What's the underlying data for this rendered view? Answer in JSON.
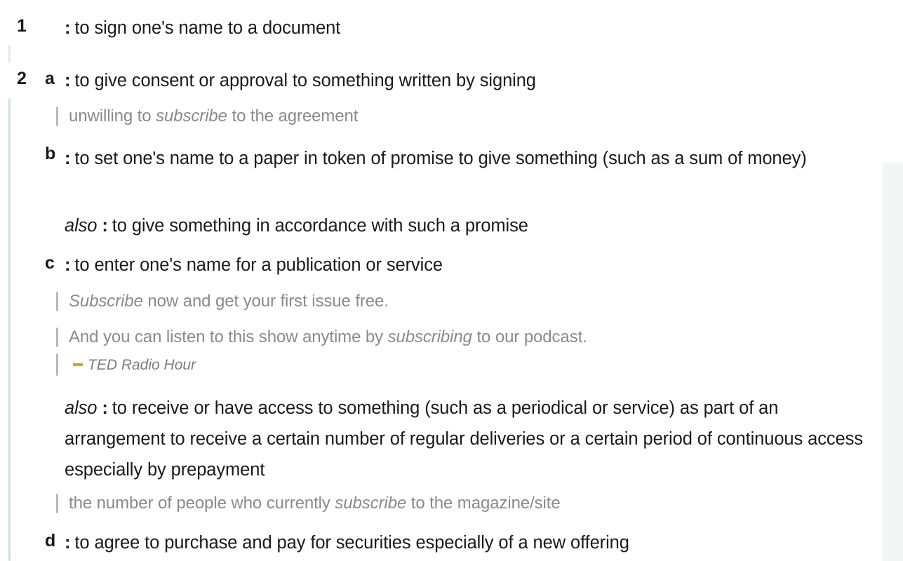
{
  "colors": {
    "sense_rule": "#cfdfd6",
    "sense_rule_faint": "#e4e7e6",
    "quote_bar": "#b9b9b9",
    "attribution_dash": "#c7a935",
    "text": "#1a1a1a",
    "example_text": "#8a8a8a",
    "side_panel": "#f4f5f5",
    "background": "#ffffff"
  },
  "senses": [
    {
      "number": "1",
      "letter": "",
      "colon": ":",
      "definition": "to sign one's name to a document"
    },
    {
      "number": "2",
      "letter": "a",
      "colon": ":",
      "definition": "to give consent or approval to something written by signing",
      "example_1_pre": "unwilling to ",
      "example_1_em": "subscribe",
      "example_1_post": " to the agreement"
    },
    {
      "number": "",
      "letter": "b",
      "colon": ":",
      "definition": "to set one's name to a paper in token of promise to give something (such as a sum of money)",
      "also_label": "also",
      "also_colon": ":",
      "also_definition": "to give something in accordance with such a promise"
    },
    {
      "number": "",
      "letter": "c",
      "colon": ":",
      "definition": "to enter one's name for a publication or service",
      "example_1_em": "Subscribe",
      "example_1_post": " now and get your first issue free.",
      "example_2_pre": "And you can listen to this show anytime by ",
      "example_2_em": "subscribing",
      "example_2_post": " to our podcast.",
      "example_2_attribution": "TED Radio Hour",
      "also_label": "also",
      "also_colon": ":",
      "also_definition": "to receive or have access to something (such as a periodical or service) as part of an arrangement to receive a certain number of regular deliveries or a certain period of continuous access especially by prepayment",
      "example_3_pre": "the number of people who currently ",
      "example_3_em": "subscribe",
      "example_3_post": " to the magazine/site"
    },
    {
      "number": "",
      "letter": "d",
      "colon": ":",
      "definition": "to agree to purchase and pay for securities especially of a new offering"
    }
  ]
}
